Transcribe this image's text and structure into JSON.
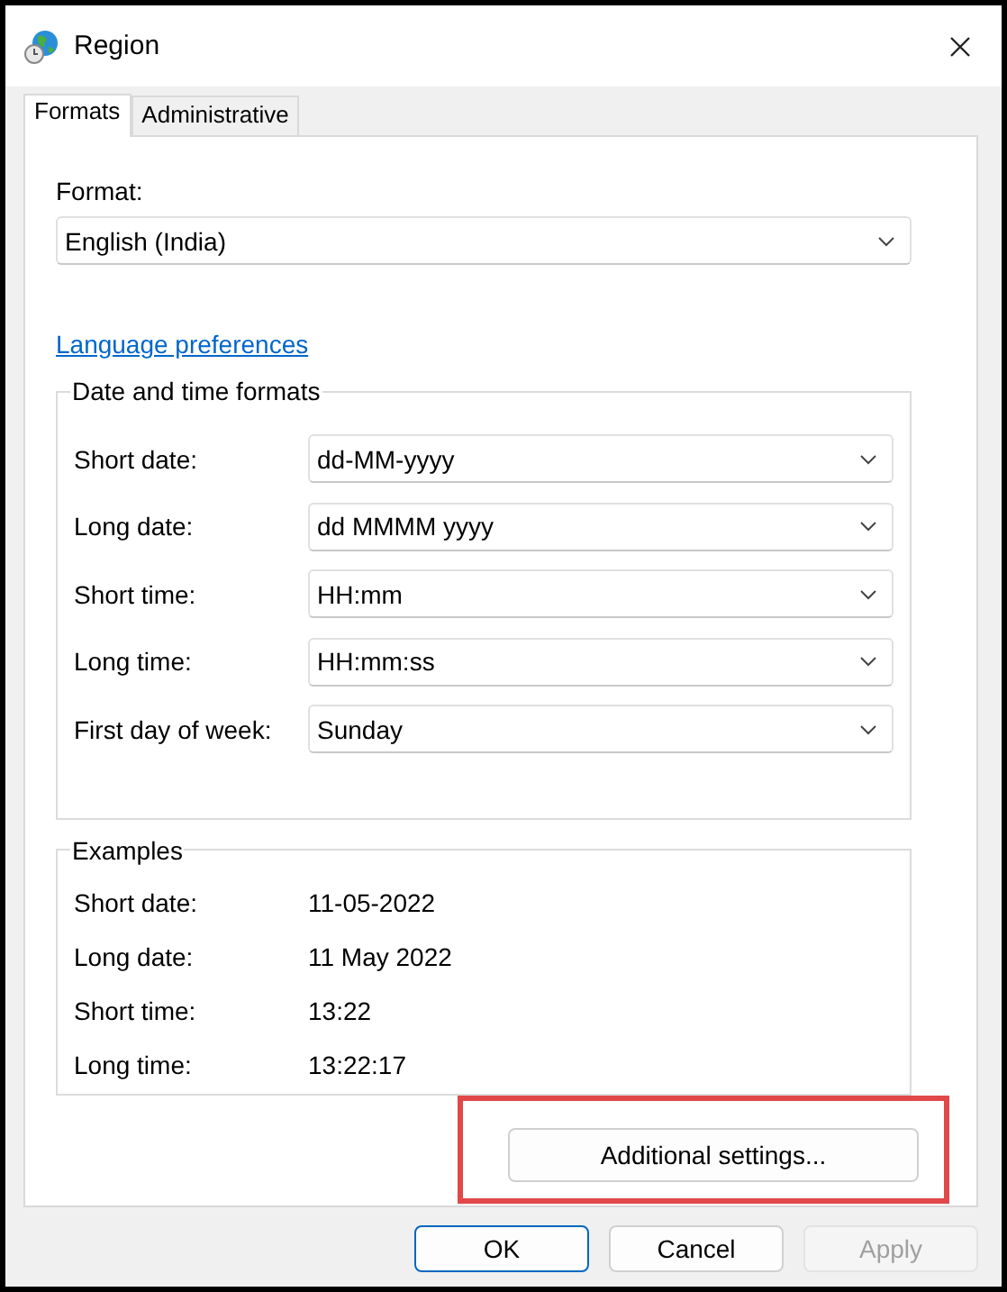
{
  "window": {
    "title": "Region"
  },
  "tabs": [
    {
      "label": "Formats",
      "selected": true
    },
    {
      "label": "Administrative",
      "selected": false
    }
  ],
  "format": {
    "label": "Format:",
    "value": "English (India)"
  },
  "language_link": "Language preferences",
  "date_time_formats": {
    "title": "Date and time formats",
    "rows": [
      {
        "label": "Short date:",
        "value": "dd-MM-yyyy"
      },
      {
        "label": "Long date:",
        "value": "dd MMMM yyyy"
      },
      {
        "label": "Short time:",
        "value": "HH:mm"
      },
      {
        "label": "Long time:",
        "value": "HH:mm:ss"
      },
      {
        "label": "First day of week:",
        "value": "Sunday"
      }
    ]
  },
  "examples": {
    "title": "Examples",
    "rows": [
      {
        "label": "Short date:",
        "value": "11-05-2022"
      },
      {
        "label": "Long date:",
        "value": "11 May 2022"
      },
      {
        "label": "Short time:",
        "value": "13:22"
      },
      {
        "label": "Long time:",
        "value": "13:22:17"
      }
    ]
  },
  "additional_settings": {
    "label": "Additional settings...",
    "highlighted": true
  },
  "buttons": [
    {
      "label": "OK",
      "default": true,
      "disabled": false
    },
    {
      "label": "Cancel",
      "default": false,
      "disabled": false
    },
    {
      "label": "Apply",
      "default": false,
      "disabled": true
    }
  ]
}
